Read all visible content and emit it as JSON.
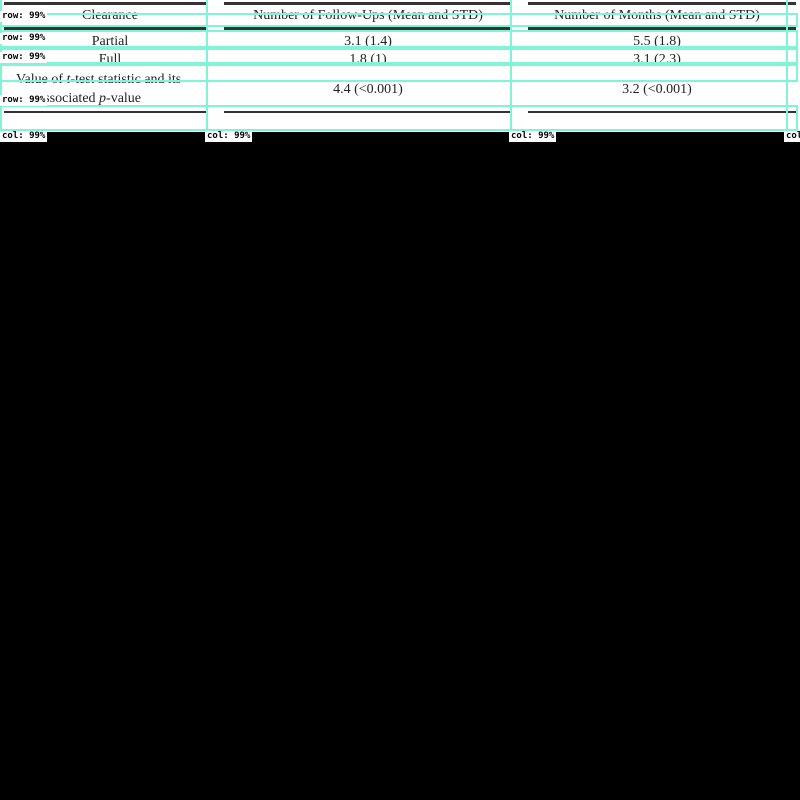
{
  "table": {
    "headers": [
      "Clearance",
      "Number of Follow-Ups (Mean and STD)",
      "Number of Months (Mean and STD)"
    ],
    "rows": [
      {
        "label": "Partial",
        "followups": "3.1 (1.4)",
        "months": "5.5 (1.8)"
      },
      {
        "label": "Full",
        "followups": "1.8 (1)",
        "months": "3.1 (2.3)"
      },
      {
        "label_line1": "Value of t-test statistic and its",
        "label_line2": "associated p-value",
        "followups": "4.4 (<0.001)",
        "months": "3.2 (<0.001)"
      }
    ]
  },
  "overlay": {
    "row_tag": "row: 99%",
    "col_tag": "col: 99%",
    "color": "#7ff5d6"
  }
}
